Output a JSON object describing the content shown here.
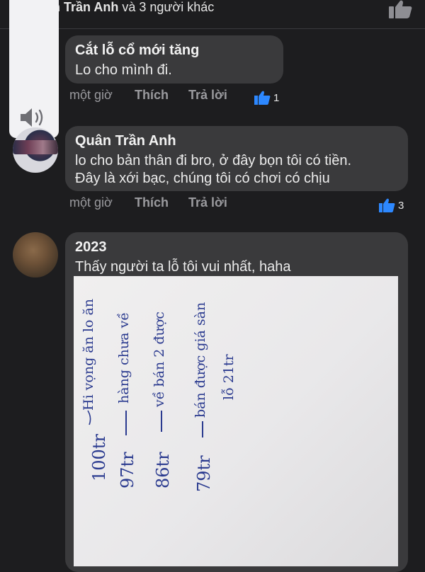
{
  "header": {
    "reactors_name": "ần Trần Anh",
    "reactors_suffix": " và 3 người khác"
  },
  "comments": [
    {
      "name": "Cắt lỗ cổ mới tăng",
      "text_lines": [
        "Lo cho mình đi."
      ],
      "time": "một giờ",
      "like_label": "Thích",
      "reply_label": "Trả lời",
      "likes": "1"
    },
    {
      "name": "Quân Trần Anh",
      "text_lines": [
        "lo cho bản thân đi bro, ở đây bọn tôi có tiền.",
        "Đây là xới bạc, chúng tôi có chơi có chịu"
      ],
      "time": "một giờ",
      "like_label": "Thích",
      "reply_label": "Trả lời",
      "likes": "3"
    },
    {
      "name": "2023",
      "text_lines": [
        "Thấy người ta lỗ tôi vui nhất, haha"
      ]
    }
  ],
  "photo_notes": [
    "100tr",
    "Hi vọng ăn lo ăn",
    "97tr",
    "hàng chưa về",
    "86tr",
    "về bán 2 được",
    "79tr",
    "bán được giá sàn",
    "lỗ 21tr"
  ],
  "icons": {
    "volume": "speaker-icon",
    "like": "thumbs-up-icon"
  },
  "colors": {
    "background": "#1d1d1f",
    "bubble": "#3a3a3c",
    "like_blue": "#2d88ff"
  }
}
